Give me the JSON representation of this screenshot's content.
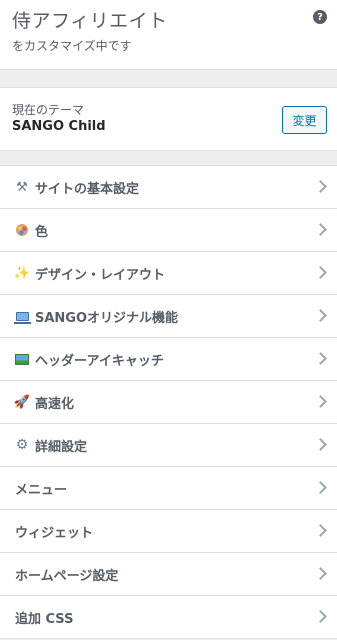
{
  "header": {
    "title": "侍アフィリエイト",
    "subtitle": "をカスタマイズ中です",
    "help_label": "?"
  },
  "theme": {
    "label": "現在のテーマ",
    "name": "SANGO Child",
    "change_button": "変更"
  },
  "menu": {
    "items": [
      {
        "label": "サイトの基本設定",
        "icon": "tools-icon"
      },
      {
        "label": "色",
        "icon": "palette-icon"
      },
      {
        "label": "デザイン・レイアウト",
        "icon": "sparkles-icon"
      },
      {
        "label": "SANGOオリジナル機能",
        "icon": "laptop-icon"
      },
      {
        "label": "ヘッダーアイキャッチ",
        "icon": "photo-icon"
      },
      {
        "label": "高速化",
        "icon": "rocket-icon"
      },
      {
        "label": "詳細設定",
        "icon": "gear-icon"
      },
      {
        "label": "メニュー",
        "icon": ""
      },
      {
        "label": "ウィジェット",
        "icon": ""
      },
      {
        "label": "ホームページ設定",
        "icon": ""
      },
      {
        "label": "追加 CSS",
        "icon": ""
      }
    ]
  },
  "colors": {
    "accent": "#0073aa",
    "background": "#eeeeee"
  }
}
